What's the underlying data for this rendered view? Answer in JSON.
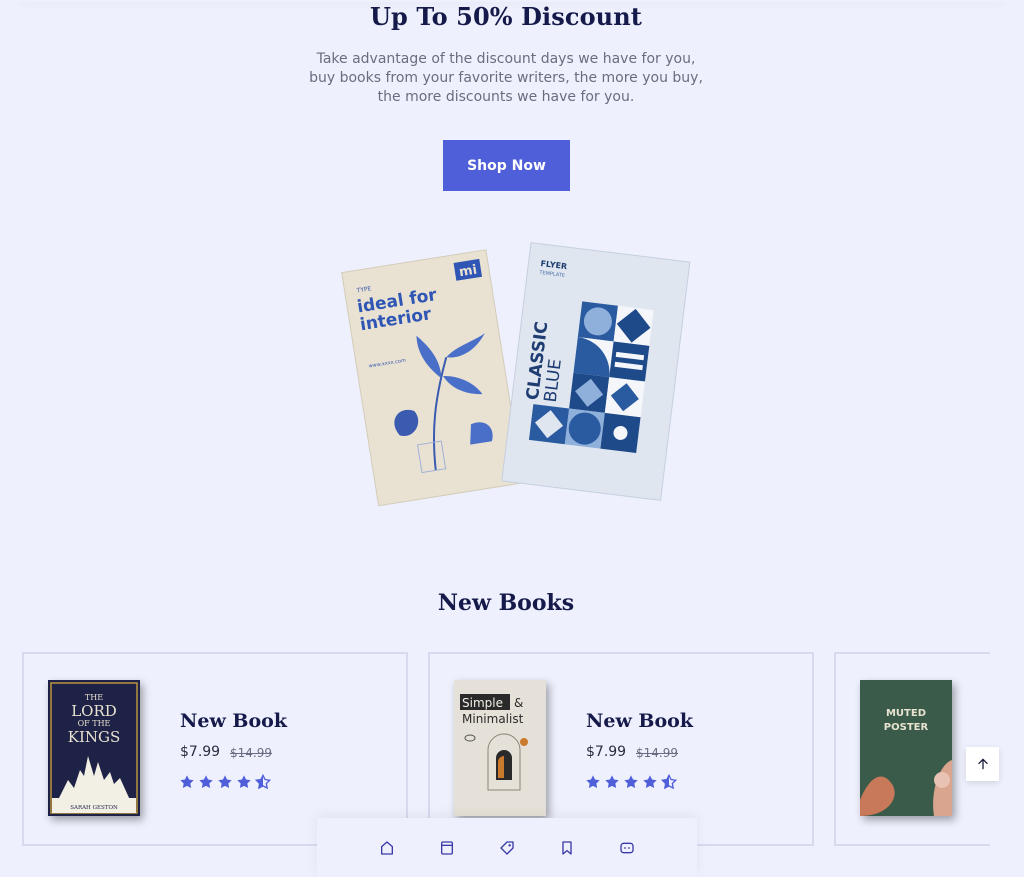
{
  "hero": {
    "title": "Up To 50% Discount",
    "subtitle_lines": [
      "Take advantage of the discount days we have for you,",
      "buy books from your favorite writers, the more you buy,",
      "the more discounts we have for you."
    ],
    "cta_label": "Shop Now",
    "book_left": {
      "type": "TYPE",
      "title_lines": [
        "ideal for",
        "interior"
      ],
      "brand": "mi",
      "site": "www.xxxx.com"
    },
    "book_right": {
      "label": "FLYER",
      "sub": "TEMPLATE",
      "title_lines": [
        "CLASSIC",
        "BLUE"
      ]
    }
  },
  "new_books": {
    "heading": "New Books",
    "items": [
      {
        "title": "New Book",
        "price": "$7.99",
        "old_price": "$14.99",
        "rating": 4.5,
        "cover": {
          "lines": [
            "THE",
            "LORD",
            "OF THE",
            "KINGS"
          ],
          "author": "SARAH GESTON"
        }
      },
      {
        "title": "New Book",
        "price": "$7.99",
        "old_price": "$14.99",
        "rating": 4.5,
        "cover": {
          "lines": [
            "Simple",
            "&",
            "Minimalist"
          ]
        }
      },
      {
        "title": "",
        "price": "",
        "old_price": "",
        "rating": 0,
        "cover": {
          "lines": [
            "MUTED",
            "POSTER"
          ]
        }
      }
    ]
  },
  "icons": {
    "scroll_top": "arrow-up-icon",
    "nav": [
      "home-icon",
      "catalog-icon",
      "tag-icon",
      "bookmark-icon",
      "chat-icon"
    ]
  },
  "colors": {
    "accent": "#4f5fd9",
    "background": "#eef0fd",
    "heading": "#151a4a",
    "star": "#4f5fd9"
  }
}
